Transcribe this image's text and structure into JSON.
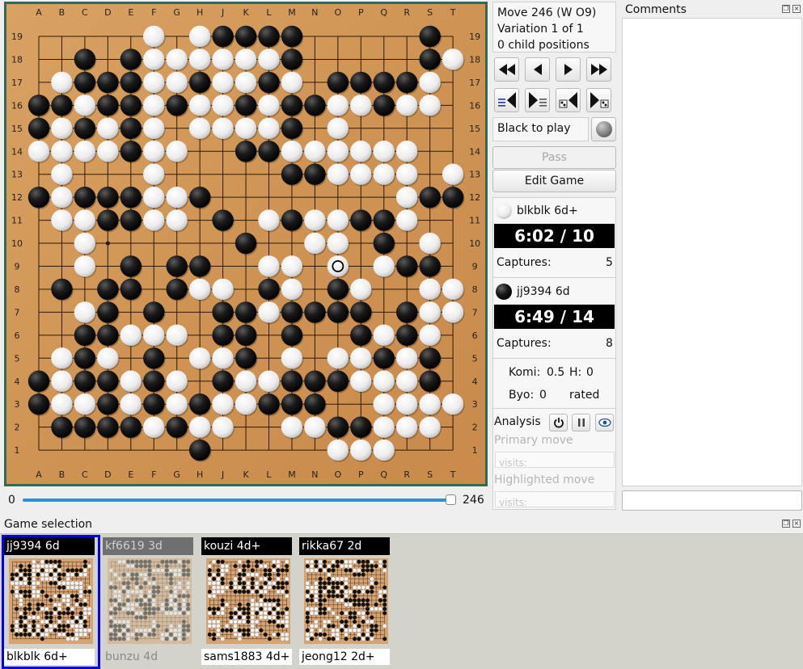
{
  "board": {
    "size": 19,
    "columns": [
      "A",
      "B",
      "C",
      "D",
      "E",
      "F",
      "G",
      "H",
      "J",
      "K",
      "L",
      "M",
      "N",
      "O",
      "P",
      "Q",
      "R",
      "S",
      "T"
    ],
    "rows": [
      "19",
      "18",
      "17",
      "16",
      "15",
      "14",
      "13",
      "12",
      "11",
      "10",
      "9",
      "8",
      "7",
      "6",
      "5",
      "4",
      "3",
      "2",
      "1"
    ],
    "position": [
      ".....W.WBBBB.....B.",
      "..B.BWWWWWWB.....BW",
      ".WBBBWWBWWBW.BBBBW.",
      "BBWBBWBWWBWBBWWBWW.",
      "BWBWBW.WWWWB.W.....",
      "WWWWBWW..BBWWWWWW..",
      ".W...W.....BBWWWW.W",
      "BWBBBWWB........WBBB",
      ".WWBBWW.B.WBWWBBW..",
      "..W......B..WW.B.W.",
      "..W.B.BB..WW.W.WBB.",
      ".B.BB.BWW.BW.BW..WW",
      "..WB.B..BBWBBBB.BWW",
      "..BBWWW.BB.B..BWBW.",
      ".WBW.B.WWB.W.WWBWB.",
      "BWBBWBW.BWWBBBWWWB.",
      "BWWBWBWBWWBBB..WWWW",
      ".BBBBWBWW..WWBBWWW.",
      ".......B.....WWW..."
    ],
    "last_move": "O9",
    "last_move_color": "W"
  },
  "slider": {
    "min": "0",
    "max": "246",
    "value": 246
  },
  "info": {
    "move": "Move 246 (W O9)",
    "variation": "Variation 1 of 1",
    "children": "0 child positions"
  },
  "to_play": "Black to play",
  "pass_label": "Pass",
  "edit_label": "Edit Game",
  "white_player": {
    "name": "blkblk 6d+",
    "clock": "6:02 / 10",
    "captures_label": "Captures:",
    "captures": "5"
  },
  "black_player": {
    "name": "jj9394 6d",
    "clock": "6:49 / 14",
    "captures_label": "Captures:",
    "captures": "8"
  },
  "komi": {
    "komi_label": "Komi:",
    "komi_value": "0.5",
    "h_label": "H:",
    "h_value": "0",
    "byo_label": "Byo:",
    "byo_value": "0",
    "rated": "rated"
  },
  "analysis": {
    "label": "Analysis",
    "primary_move": "Primary move",
    "highlighted_move": "Highlighted move",
    "visits": "visits:"
  },
  "comments": {
    "title": "Comments"
  },
  "game_selection": {
    "title": "Game selection",
    "games": [
      {
        "top": "jj9394 6d",
        "bottom": "blkblk 6d+"
      },
      {
        "top": "kf6619 3d",
        "bottom": "bunzu 4d"
      },
      {
        "top": "kouzi 4d+",
        "bottom": "sams1883 4d+"
      },
      {
        "top": "rikka67 2d",
        "bottom": "jeong12 2d+"
      }
    ]
  },
  "colors": {
    "board_wood": "#d39a5c",
    "frame": "#2f6b55",
    "selection": "#0000ee",
    "slider": "#2d8fd6"
  }
}
